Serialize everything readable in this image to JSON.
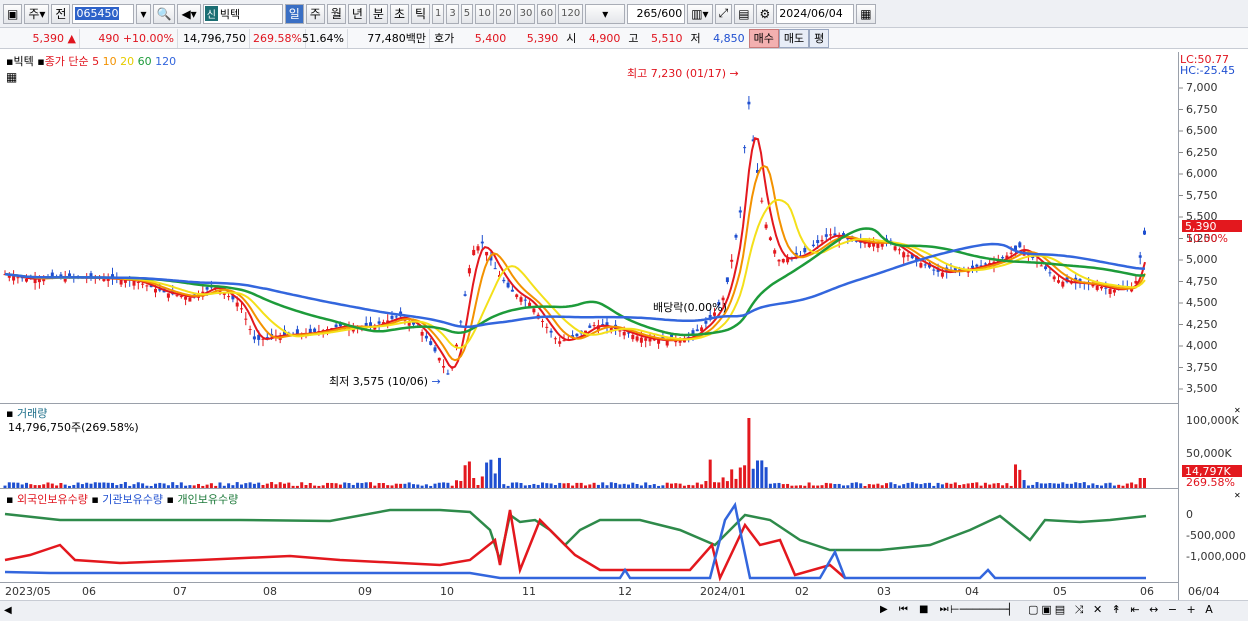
{
  "toolbar": {
    "mode": "주",
    "prev": "전",
    "code": "065450",
    "badge": "신",
    "stock_name": "빅텍",
    "periods": [
      "일",
      "주",
      "월",
      "년",
      "분",
      "초",
      "틱"
    ],
    "intervals": [
      "1",
      "3",
      "5",
      "10",
      "20",
      "30",
      "60",
      "120"
    ],
    "count": "265",
    "count_total": "/600",
    "date": "2024/06/04"
  },
  "quote": {
    "price": "5,390",
    "change": "490",
    "change_pct": "+10.00%",
    "volume": "14,796,750",
    "vol_ratio": "269.58%",
    "turnover": "51.64%",
    "amount": "77,480백만",
    "bid_label": "호가",
    "bid1": "5,400",
    "bid2": "5,390",
    "open_label": "시",
    "open": "4,900",
    "high_label": "고",
    "high": "5,510",
    "low_label": "저",
    "low": "4,850",
    "buy": "매수",
    "sell": "매도",
    "eval": "평"
  },
  "price_panel": {
    "ma_label": "종가 단순",
    "stock_tag": "빅텍",
    "ma_periods": [
      "5",
      "10",
      "20",
      "60",
      "120"
    ],
    "ma_colors": [
      "#e3181e",
      "#f39200",
      "#f4e01a",
      "#1d9b3a",
      "#3366dd"
    ],
    "lc": "LC:50.77",
    "hc": "HC:-25.45",
    "yticks": [
      "7,000",
      "6,750",
      "6,500",
      "6,250",
      "6,000",
      "5,750",
      "5,500",
      "5,250",
      "5,000",
      "4,750",
      "4,500",
      "4,250",
      "4,000",
      "3,750",
      "3,500"
    ],
    "last_price": "5,390",
    "last_pct": "10.00%",
    "high_note": "최고 7,230 (01/17)",
    "low_note": "최저 3,575 (10/06)",
    "dividend_note": "배당락(0.00%)"
  },
  "volume_panel": {
    "title": "거래량",
    "value": "14,796,750주(269.58%)",
    "yticks": [
      "100,000K",
      "50,000K"
    ],
    "last": "14,797K",
    "last_pct": "269.58%"
  },
  "holder_panel": {
    "s1": "외국인보유수량",
    "s2": "기관보유수량",
    "s3": "개인보유수량",
    "yticks": [
      "0",
      "-500,000",
      "-1,000,000"
    ]
  },
  "xaxis": [
    "2023/05",
    "06",
    "07",
    "08",
    "09",
    "10",
    "11",
    "12",
    "2024/01",
    "02",
    "03",
    "04",
    "05",
    "06"
  ],
  "xaxis_end": "06/04"
}
